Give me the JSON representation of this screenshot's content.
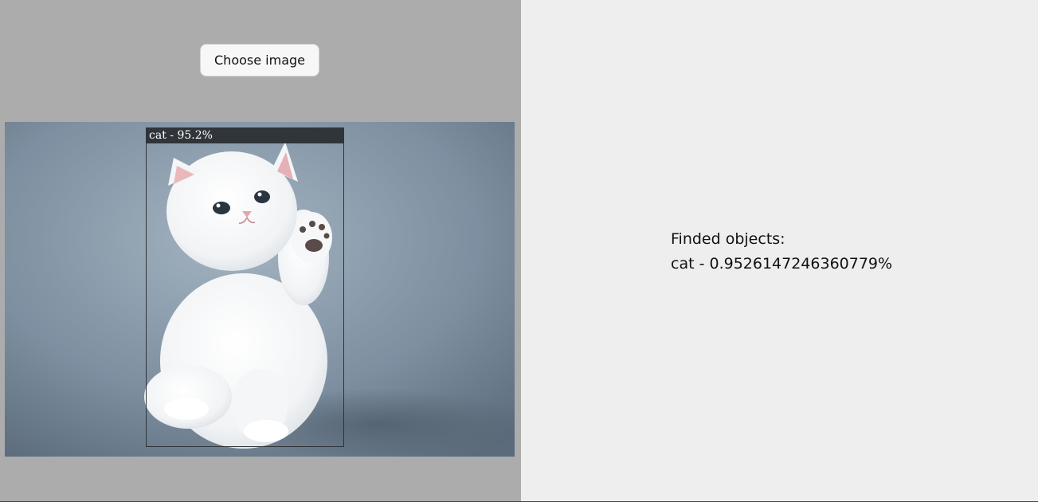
{
  "upload": {
    "button_label": "Choose image"
  },
  "detection": {
    "label": "cat - 95.2%"
  },
  "results": {
    "heading": "Finded objects:",
    "items": [
      "cat - 0.9526147246360779%"
    ]
  },
  "colors": {
    "left_panel_bg": "#acacac",
    "right_panel_bg": "#eeeeee",
    "photo_background": "#7e8fa0",
    "box_border": "#2f3338"
  },
  "icons": {
    "photo_subject": "white-kitten-image"
  }
}
